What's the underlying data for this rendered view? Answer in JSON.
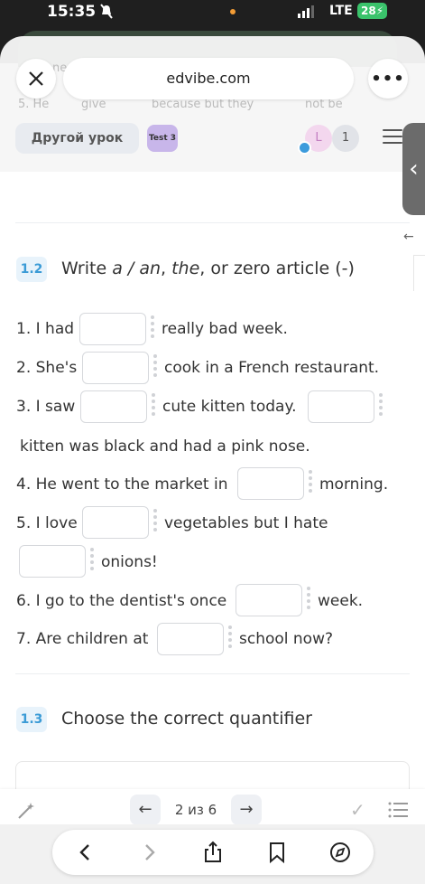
{
  "status_bar": {
    "time": "15:35",
    "network": "LTE",
    "battery": "28"
  },
  "browser": {
    "url": "edvibe.com"
  },
  "background_ghost": {
    "text1": "ne",
    "text2": "5. He",
    "text3": "give",
    "text4": "because but they",
    "text5": "not be"
  },
  "lesson_header": {
    "other_lesson": "Другой урок",
    "test_badge": "Test 3",
    "avatar_letter": "L",
    "participants_count": "1"
  },
  "section_1_2": {
    "number": "1.2",
    "title_part1": "Write ",
    "title_italic1": "a / an",
    "title_part2": ", ",
    "title_italic2": "the",
    "title_part3": ", or zero article (-)",
    "lines": {
      "l1a": "1. I had",
      "l1b": "really bad week.",
      "l2a": "2. She's",
      "l2b": "cook in a French restaurant.",
      "l3a": "3. I saw",
      "l3b": "cute kitten today.",
      "l3c": "kitten was black and had a pink nose.",
      "l4a": "4. He went to the market in",
      "l4b": "morning.",
      "l5a": "5. I love",
      "l5b": "vegetables but I hate",
      "l5c": "onions!",
      "l6a": "6. I go to the dentist's once",
      "l6b": "week.",
      "l7a": "7. Are children at",
      "l7b": "school now?"
    }
  },
  "section_1_3": {
    "number": "1.3",
    "title": "Choose the correct quantifier"
  },
  "pager": {
    "label": "2 из 6"
  },
  "icons": {
    "close": "close-icon",
    "more": "more-icon",
    "menu": "hamburger-icon",
    "side": "chevron-left-icon",
    "wand": "magic-wand-icon",
    "back": "back-icon",
    "forward": "forward-icon",
    "share": "share-icon",
    "bookmarks": "bookmarks-icon",
    "compass": "compass-icon"
  },
  "colors": {
    "accent_blue": "#3b9bd6",
    "test_badge": "#c8b6ea",
    "status_green": "#3ac36b"
  }
}
